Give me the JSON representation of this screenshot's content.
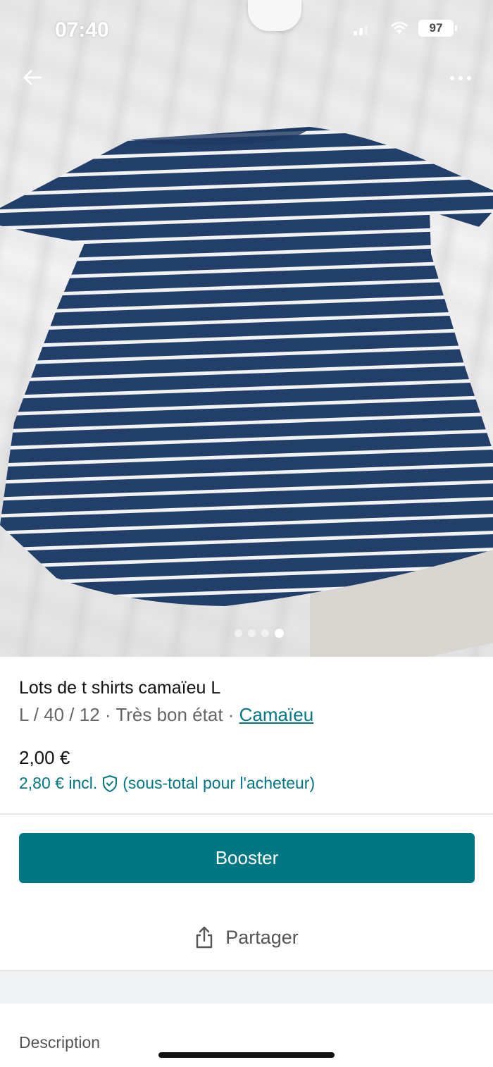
{
  "status_bar": {
    "time": "07:40",
    "battery": "97"
  },
  "carousel": {
    "page_count": 4,
    "active_index": 3
  },
  "listing": {
    "title": "Lots de t shirts camaïeu L",
    "size_condition": "L / 40 / 12 · Très bon état · ",
    "brand": "Camaïeu",
    "price": "2,00 €",
    "buyer_price": "2,80 € incl.",
    "buyer_price_note": "(sous-total pour l'acheteur)"
  },
  "actions": {
    "boost_label": "Booster",
    "share_label": "Partager"
  },
  "description": {
    "label": "Description"
  },
  "colors": {
    "accent": "#007782",
    "text": "#111111",
    "muted": "#666666"
  }
}
